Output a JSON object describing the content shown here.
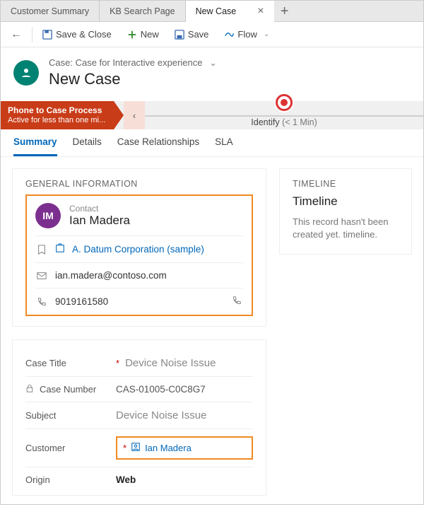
{
  "tabs": [
    {
      "label": "Customer Summary"
    },
    {
      "label": "KB Search Page"
    },
    {
      "label": "New Case",
      "active": true
    }
  ],
  "commands": {
    "save_close": "Save & Close",
    "new": "New",
    "save": "Save",
    "flow": "Flow"
  },
  "header": {
    "breadcrumb": "Case: Case for Interactive experience",
    "title": "New Case"
  },
  "process": {
    "name": "Phone to Case Process",
    "status": "Active for less than one mi...",
    "stage": "Identify",
    "stage_time": "(< 1 Min)"
  },
  "subtabs": [
    "Summary",
    "Details",
    "Case Relationships",
    "SLA"
  ],
  "general": {
    "section_title": "GENERAL INFORMATION",
    "contact_label": "Contact",
    "contact_name": "Ian Madera",
    "contact_initials": "IM",
    "company": "A. Datum Corporation (sample)",
    "email": "ian.madera@contoso.com",
    "phone": "9019161580"
  },
  "case": {
    "title_label": "Case Title",
    "title_value": "Device Noise Issue",
    "number_label": "Case Number",
    "number_value": "CAS-01005-C0C8G7",
    "subject_label": "Subject",
    "subject_value": "Device Noise Issue",
    "customer_label": "Customer",
    "customer_value": "Ian Madera",
    "origin_label": "Origin",
    "origin_value": "Web"
  },
  "timeline": {
    "section_title": "TIMELINE",
    "heading": "Timeline",
    "message": "This record hasn't been created yet. timeline."
  }
}
